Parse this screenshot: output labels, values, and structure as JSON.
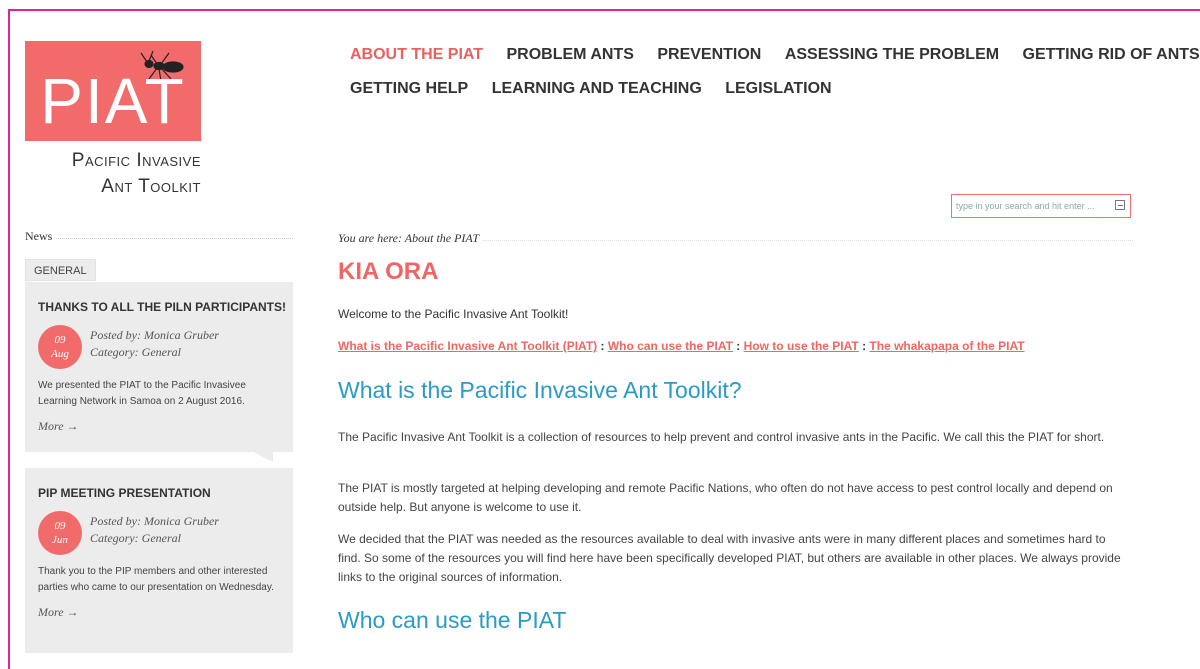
{
  "logo": {
    "text": "PIAT",
    "subtitle_line1": "Pacific Invasive",
    "subtitle_line2": "Ant Toolkit",
    "bg_color": "#f26b6b"
  },
  "nav": {
    "row1": [
      "ABOUT THE PIAT",
      "PROBLEM ANTS",
      "PREVENTION",
      "ASSESSING THE PROBLEM",
      "GETTING RID OF ANTS"
    ],
    "row2": [
      "GETTING HELP",
      "LEARNING AND TEACHING",
      "LEGISLATION"
    ],
    "active": "ABOUT THE PIAT",
    "active_color": "#e9605f"
  },
  "search": {
    "placeholder": "type in your search and hit enter ..."
  },
  "sidebar": {
    "heading": "News",
    "tab": "GENERAL",
    "posts": [
      {
        "title": "THANKS TO ALL THE PILN PARTICIPANTS!",
        "day": "09",
        "month": "Aug",
        "posted_by": "Posted by: Monica Gruber",
        "category": "Category: General",
        "body": "We presented the PIAT to the Pacific Invasivee Learning Network in Samoa on 2 August 2016.",
        "more": "More →"
      },
      {
        "title": "PIP MEETING PRESENTATION",
        "day": "09",
        "month": "Jun",
        "posted_by": "Posted by: Monica Gruber",
        "category": "Category: General",
        "body": "Thank you to the PIP members and other interested parties who came to our presentation on Wednesday.",
        "more": "More →"
      }
    ]
  },
  "main": {
    "breadcrumb": "You are here: About the PIAT",
    "title": "KIA ORA",
    "welcome": "Welcome to the Pacific Invasive Ant Toolkit!",
    "links": [
      "What is the Pacific Invasive Ant Toolkit (PIAT)",
      "Who can use the PIAT",
      "How to use the PIAT",
      "The whakapapa of the PIAT"
    ],
    "link_separator": " : ",
    "section1_heading": "What is the Pacific Invasive Ant Toolkit?",
    "paragraphs": [
      "The Pacific Invasive Ant Toolkit is a collection of resources to help prevent and control invasive ants in the Pacific. We call this the PIAT for short.",
      "The PIAT is mostly targeted at helping developing and remote Pacific Nations, who often do not have access to pest control locally and depend on outside help. But anyone is welcome to use it.",
      "We decided that the PIAT was needed as the resources available to deal with invasive ants were in many different places and sometimes hard to find. So some of the resources you will find here have been specifically developed PIAT, but others are available in other places. We always provide links to the original sources of information."
    ],
    "section2_heading": "Who can use the PIAT",
    "heading_color": "#2a9bc4",
    "title_color": "#f06565"
  }
}
